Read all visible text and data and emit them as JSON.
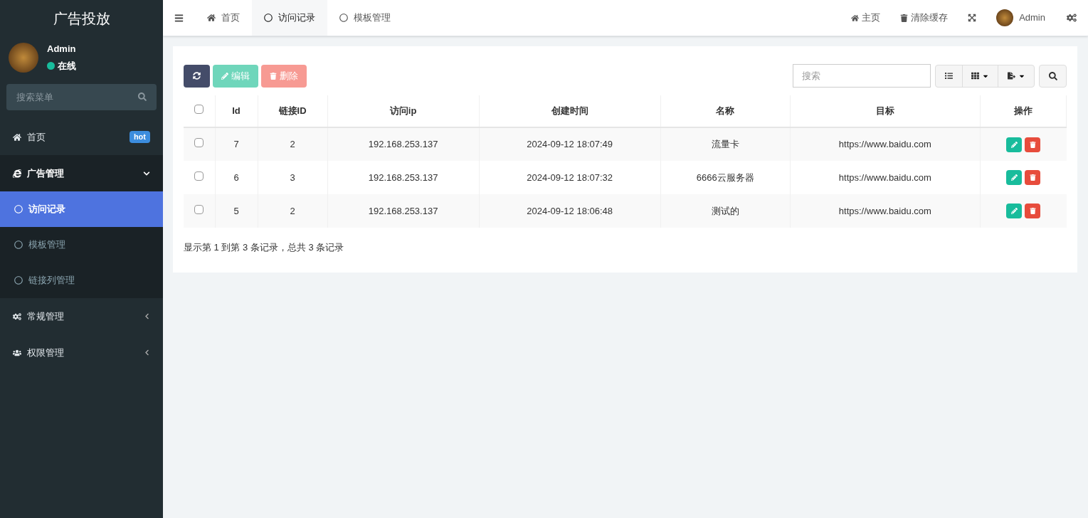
{
  "sidebar": {
    "title": "广告投放",
    "user": {
      "name": "Admin",
      "status": "在线",
      "online": true
    },
    "search": {
      "placeholder": "搜索菜单"
    },
    "items": [
      {
        "label": "首页",
        "badge": "hot",
        "selected": false
      },
      {
        "label": "广告管理",
        "expanded": true,
        "selected": false,
        "children": [
          {
            "label": "访问记录",
            "selected": true
          },
          {
            "label": "模板管理",
            "selected": false
          },
          {
            "label": "链接列管理",
            "selected": false
          }
        ]
      },
      {
        "label": "常规管理",
        "expanded": false,
        "selected": false
      },
      {
        "label": "权限管理",
        "expanded": false,
        "selected": false
      }
    ]
  },
  "tabs": [
    {
      "label": "首页",
      "selected": false
    },
    {
      "label": "访问记录",
      "selected": true
    },
    {
      "label": "模板管理",
      "selected": false
    }
  ],
  "topbar": {
    "home": "主页",
    "clear_cache": "清除缓存",
    "user": "Admin"
  },
  "toolbar": {
    "edit": "编辑",
    "delete": "删除",
    "search": {
      "placeholder": "搜索"
    }
  },
  "table": {
    "columns": [
      "Id",
      "链接ID",
      "访问ip",
      "创建时间",
      "名称",
      "目标",
      "操作"
    ],
    "rows": [
      {
        "checked": false,
        "cells": [
          "7",
          "2",
          "192.168.253.137",
          "2024-09-12 18:07:49",
          "流量卡",
          "https://www.baidu.com"
        ]
      },
      {
        "checked": false,
        "cells": [
          "6",
          "3",
          "192.168.253.137",
          "2024-09-12 18:07:32",
          "6666云服务器",
          "https://www.baidu.com"
        ]
      },
      {
        "checked": false,
        "cells": [
          "5",
          "2",
          "192.168.253.137",
          "2024-09-12 18:06:48",
          "测试的",
          "https://www.baidu.com"
        ]
      }
    ],
    "header_checked": false,
    "summary": "显示第 1 到第 3 条记录，总共 3 条记录"
  }
}
